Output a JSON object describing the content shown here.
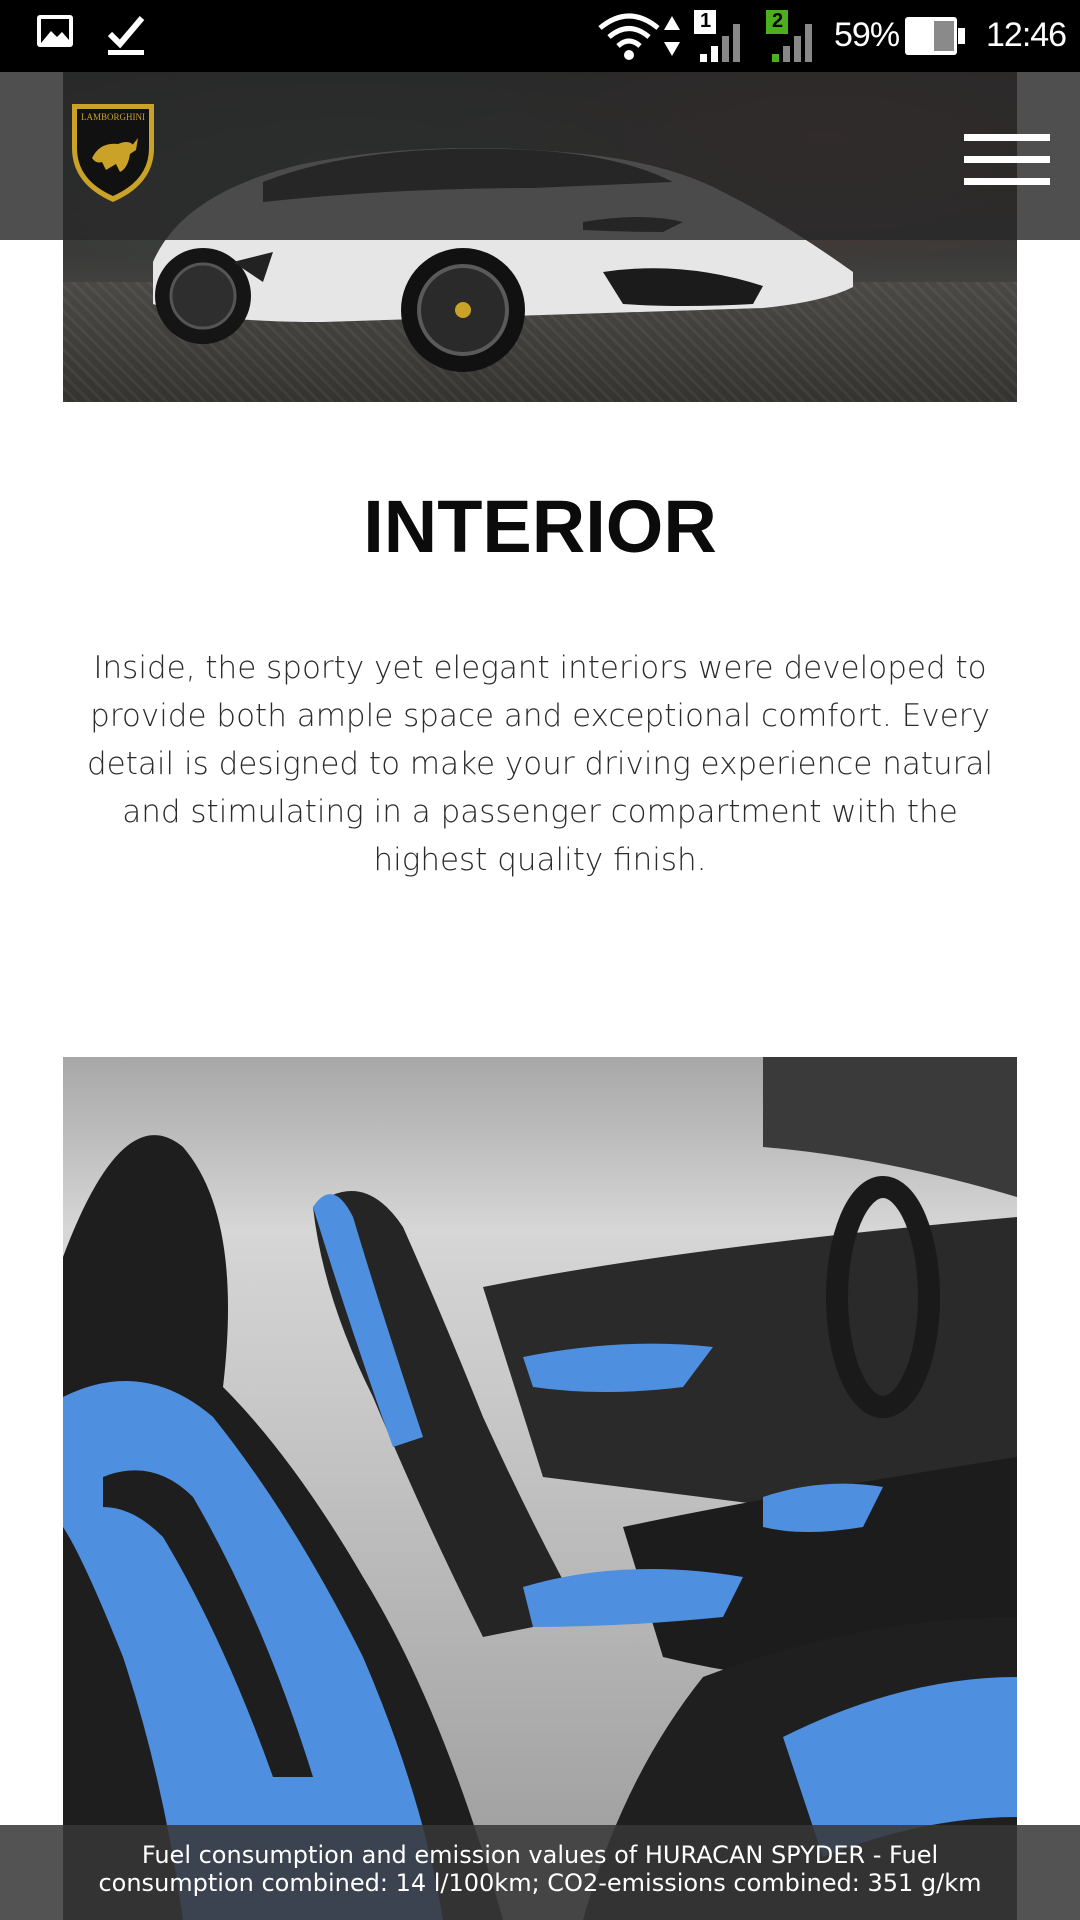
{
  "status_bar": {
    "battery_percent": "59%",
    "time": "12:46",
    "sim1_label": "1",
    "sim2_label": "2",
    "icons": [
      "gallery-icon",
      "download-complete-icon",
      "wifi-icon",
      "data-arrows-icon",
      "signal-sim1-icon",
      "signal-sim2-icon",
      "battery-icon"
    ],
    "sim2_color": "#4caf1f"
  },
  "header": {
    "logo_text": "LAMBORGHINI",
    "menu_icon": "hamburger-menu-icon"
  },
  "content": {
    "title": "INTERIOR",
    "body": "Inside, the sporty yet elegant interiors were developed to provide both ample space and exceptional comfort. Every detail is designed to make your driving experience natural and stimulating in a passenger compartment with the highest quality finish."
  },
  "footer": {
    "disclaimer": "Fuel consumption and emission values of HURACAN SPYDER - Fuel consumption combined: 14 l/100km; CO2-emissions combined: 351 g/km"
  },
  "colors": {
    "status_bar_bg": "#000000",
    "nav_overlay": "#282828",
    "seat_blue": "#4f8fe0",
    "logo_gold": "#c9a227"
  }
}
